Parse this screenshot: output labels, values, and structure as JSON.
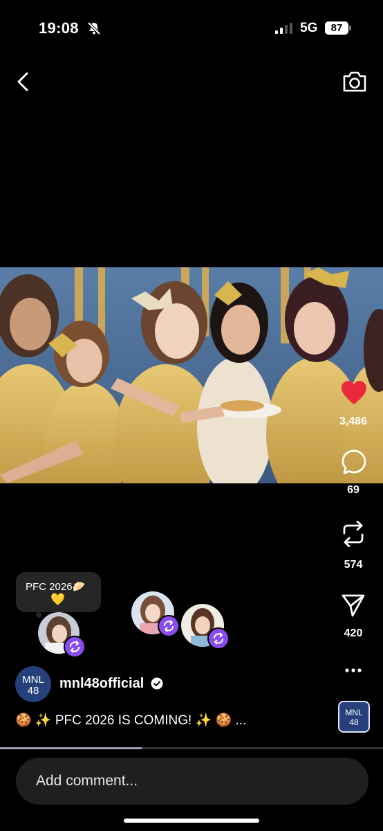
{
  "status_bar": {
    "time": "19:08",
    "network": "5G",
    "battery": "87"
  },
  "post": {
    "account_name": "mnl48official",
    "account_avatar_text": "MNL48",
    "caption": "🍪 ✨ PFC 2026 IS COMING! ✨ 🍪 ...",
    "video_progress": 0.37
  },
  "actions": {
    "likes": "3,486",
    "comments": "69",
    "reposts": "574",
    "shares": "420"
  },
  "repost_bubble": {
    "text": "PFC 2026🥟",
    "emoji": "💛"
  },
  "comment": {
    "placeholder": "Add comment..."
  },
  "icons": [
    "bell-muted-icon",
    "signal-icon",
    "back-icon",
    "camera-icon",
    "heart-icon",
    "comment-icon",
    "repost-icon",
    "share-icon",
    "more-icon",
    "verified-icon"
  ],
  "colors": {
    "like": "#e8293b",
    "repost_badge": "#8a4cf0",
    "brand": "#25407a"
  }
}
